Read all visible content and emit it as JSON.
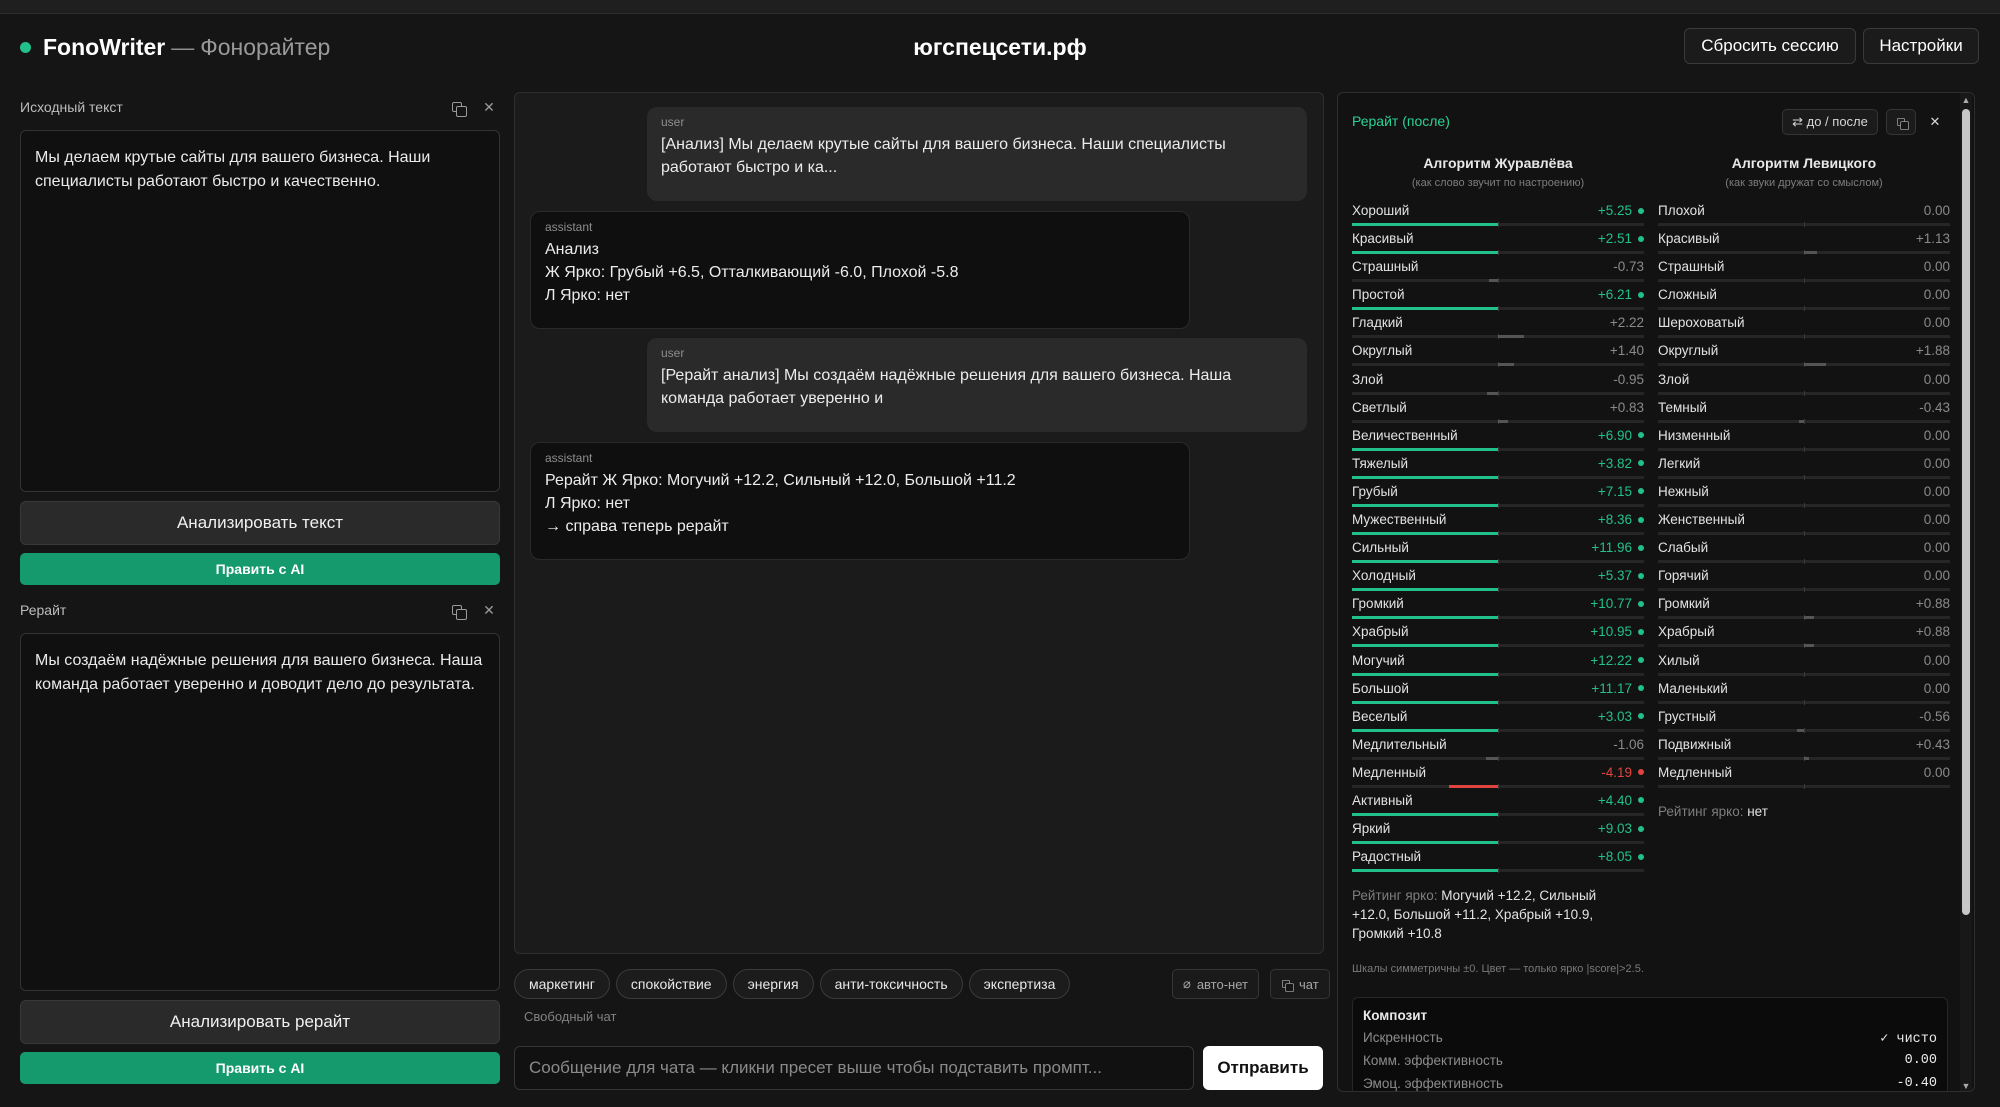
{
  "header": {
    "brand_name": "FonoWriter",
    "brand_sep": "—",
    "brand_subtitle": "Фонорайтер",
    "site": "югспецсети.рф",
    "reset_label": "Сбросить сессию",
    "settings_label": "Настройки"
  },
  "source": {
    "title": "Исходный текст",
    "text": "Мы делаем крутые сайты для вашего бизнеса. Наши специалисты работают быстро и качественно.",
    "analyze_label": "Анализировать текст",
    "ai_label": "Править с AI"
  },
  "rewrite": {
    "title": "Рерайт",
    "text": "Мы создаём надёжные решения для вашего бизнеса. Наша команда работает уверенно и доводит дело до результата.",
    "analyze_label": "Анализировать рерайт",
    "ai_label": "Править с AI"
  },
  "chat": {
    "messages": [
      {
        "role": "user",
        "text": "[Анализ] Мы делаем крутые сайты для вашего бизнеса. Наши специалисты работают быстро и ка..."
      },
      {
        "role": "assistant",
        "text": "Анализ\nЖ Ярко: Грубый +6.5, Отталкивающий -6.0, Плохой -5.8\nЛ Ярко: нет"
      },
      {
        "role": "user",
        "text": "[Рерайт анализ] Мы создаём надёжные решения для вашего бизнеса. Наша команда работает уверенно и"
      },
      {
        "role": "assistant",
        "text": "Рерайт Ж Ярко: Могучий +12.2, Сильный +12.0, Большой +11.2\nЛ Ярко: нет\n→ справа теперь рерайт"
      }
    ],
    "presets": [
      "маркетинг",
      "спокойствие",
      "энергия",
      "анти-токсичность",
      "экспертиза"
    ],
    "auto_label": "авто-нет",
    "chat_toggle_label": "чат",
    "free_chat_label": "Свободный чат",
    "input_placeholder": "Сообщение для чата — кликни пресет выше чтобы подставить промпт...",
    "send_label": "Отправить"
  },
  "panel": {
    "title": "Рерайт (после)",
    "compare_label": "⇄ до / после",
    "colors": {
      "positive": "#22c08a",
      "negative": "#e0443e",
      "neutral": "#555555"
    },
    "zhuravlev": {
      "title": "Алгоритм Журавлёва",
      "subtitle": "(как слово звучит по настроению)",
      "rows": [
        {
          "label": "Хороший",
          "value": "+5.25",
          "score": 5.25,
          "bright": true
        },
        {
          "label": "Красивый",
          "value": "+2.51",
          "score": 2.51,
          "bright": true
        },
        {
          "label": "Страшный",
          "value": "-0.73",
          "score": -0.73,
          "bright": false
        },
        {
          "label": "Простой",
          "value": "+6.21",
          "score": 6.21,
          "bright": true
        },
        {
          "label": "Гладкий",
          "value": "+2.22",
          "score": 2.22,
          "bright": false
        },
        {
          "label": "Округлый",
          "value": "+1.40",
          "score": 1.4,
          "bright": false
        },
        {
          "label": "Злой",
          "value": "-0.95",
          "score": -0.95,
          "bright": false
        },
        {
          "label": "Светлый",
          "value": "+0.83",
          "score": 0.83,
          "bright": false
        },
        {
          "label": "Величественный",
          "value": "+6.90",
          "score": 6.9,
          "bright": true
        },
        {
          "label": "Тяжелый",
          "value": "+3.82",
          "score": 3.82,
          "bright": true
        },
        {
          "label": "Грубый",
          "value": "+7.15",
          "score": 7.15,
          "bright": true
        },
        {
          "label": "Мужественный",
          "value": "+8.36",
          "score": 8.36,
          "bright": true
        },
        {
          "label": "Сильный",
          "value": "+11.96",
          "score": 11.96,
          "bright": true
        },
        {
          "label": "Холодный",
          "value": "+5.37",
          "score": 5.37,
          "bright": true
        },
        {
          "label": "Громкий",
          "value": "+10.77",
          "score": 10.77,
          "bright": true
        },
        {
          "label": "Храбрый",
          "value": "+10.95",
          "score": 10.95,
          "bright": true
        },
        {
          "label": "Могучий",
          "value": "+12.22",
          "score": 12.22,
          "bright": true
        },
        {
          "label": "Большой",
          "value": "+11.17",
          "score": 11.17,
          "bright": true
        },
        {
          "label": "Веселый",
          "value": "+3.03",
          "score": 3.03,
          "bright": true
        },
        {
          "label": "Медлительный",
          "value": "-1.06",
          "score": -1.06,
          "bright": false
        },
        {
          "label": "Медленный",
          "value": "-4.19",
          "score": -4.19,
          "bright": true
        },
        {
          "label": "Активный",
          "value": "+4.40",
          "score": 4.4,
          "bright": true
        },
        {
          "label": "Яркий",
          "value": "+9.03",
          "score": 9.03,
          "bright": true
        },
        {
          "label": "Радостный",
          "value": "+8.05",
          "score": 8.05,
          "bright": true
        }
      ],
      "rating_label": "Рейтинг ярко:",
      "rating_value": "Могучий +12.2, Сильный +12.0, Большой +11.2, Храбрый +10.9, Громкий +10.8"
    },
    "levitsky": {
      "title": "Алгоритм Левицкого",
      "subtitle": "(как звуки дружат со смыслом)",
      "rows": [
        {
          "label": "Плохой",
          "value": "0.00",
          "score": 0,
          "bright": false
        },
        {
          "label": "Красивый",
          "value": "+1.13",
          "score": 1.13,
          "bright": false
        },
        {
          "label": "Страшный",
          "value": "0.00",
          "score": 0,
          "bright": false
        },
        {
          "label": "Сложный",
          "value": "0.00",
          "score": 0,
          "bright": false
        },
        {
          "label": "Шероховатый",
          "value": "0.00",
          "score": 0,
          "bright": false
        },
        {
          "label": "Округлый",
          "value": "+1.88",
          "score": 1.88,
          "bright": false
        },
        {
          "label": "Злой",
          "value": "0.00",
          "score": 0,
          "bright": false
        },
        {
          "label": "Темный",
          "value": "-0.43",
          "score": -0.43,
          "bright": false
        },
        {
          "label": "Низменный",
          "value": "0.00",
          "score": 0,
          "bright": false
        },
        {
          "label": "Легкий",
          "value": "0.00",
          "score": 0,
          "bright": false
        },
        {
          "label": "Нежный",
          "value": "0.00",
          "score": 0,
          "bright": false
        },
        {
          "label": "Женственный",
          "value": "0.00",
          "score": 0,
          "bright": false
        },
        {
          "label": "Слабый",
          "value": "0.00",
          "score": 0,
          "bright": false
        },
        {
          "label": "Горячий",
          "value": "0.00",
          "score": 0,
          "bright": false
        },
        {
          "label": "Громкий",
          "value": "+0.88",
          "score": 0.88,
          "bright": false
        },
        {
          "label": "Храбрый",
          "value": "+0.88",
          "score": 0.88,
          "bright": false
        },
        {
          "label": "Хилый",
          "value": "0.00",
          "score": 0,
          "bright": false
        },
        {
          "label": "Маленький",
          "value": "0.00",
          "score": 0,
          "bright": false
        },
        {
          "label": "Грустный",
          "value": "-0.56",
          "score": -0.56,
          "bright": false
        },
        {
          "label": "Подвижный",
          "value": "+0.43",
          "score": 0.43,
          "bright": false
        },
        {
          "label": "Медленный",
          "value": "0.00",
          "score": 0,
          "bright": false
        }
      ],
      "rating_label": "Рейтинг ярко:",
      "rating_value": "нет"
    },
    "scale_max": 12.5,
    "footnote": "Шкалы симметричны ±0. Цвет — только ярко |score|>2.5.",
    "composite": {
      "title": "Композит",
      "rows": [
        {
          "label": "Искренность",
          "value": "✓ чисто"
        },
        {
          "label": "Комм. эффективность",
          "value": "0.00"
        },
        {
          "label": "Эмоц. эффективность",
          "value": "-0.40"
        }
      ]
    }
  }
}
